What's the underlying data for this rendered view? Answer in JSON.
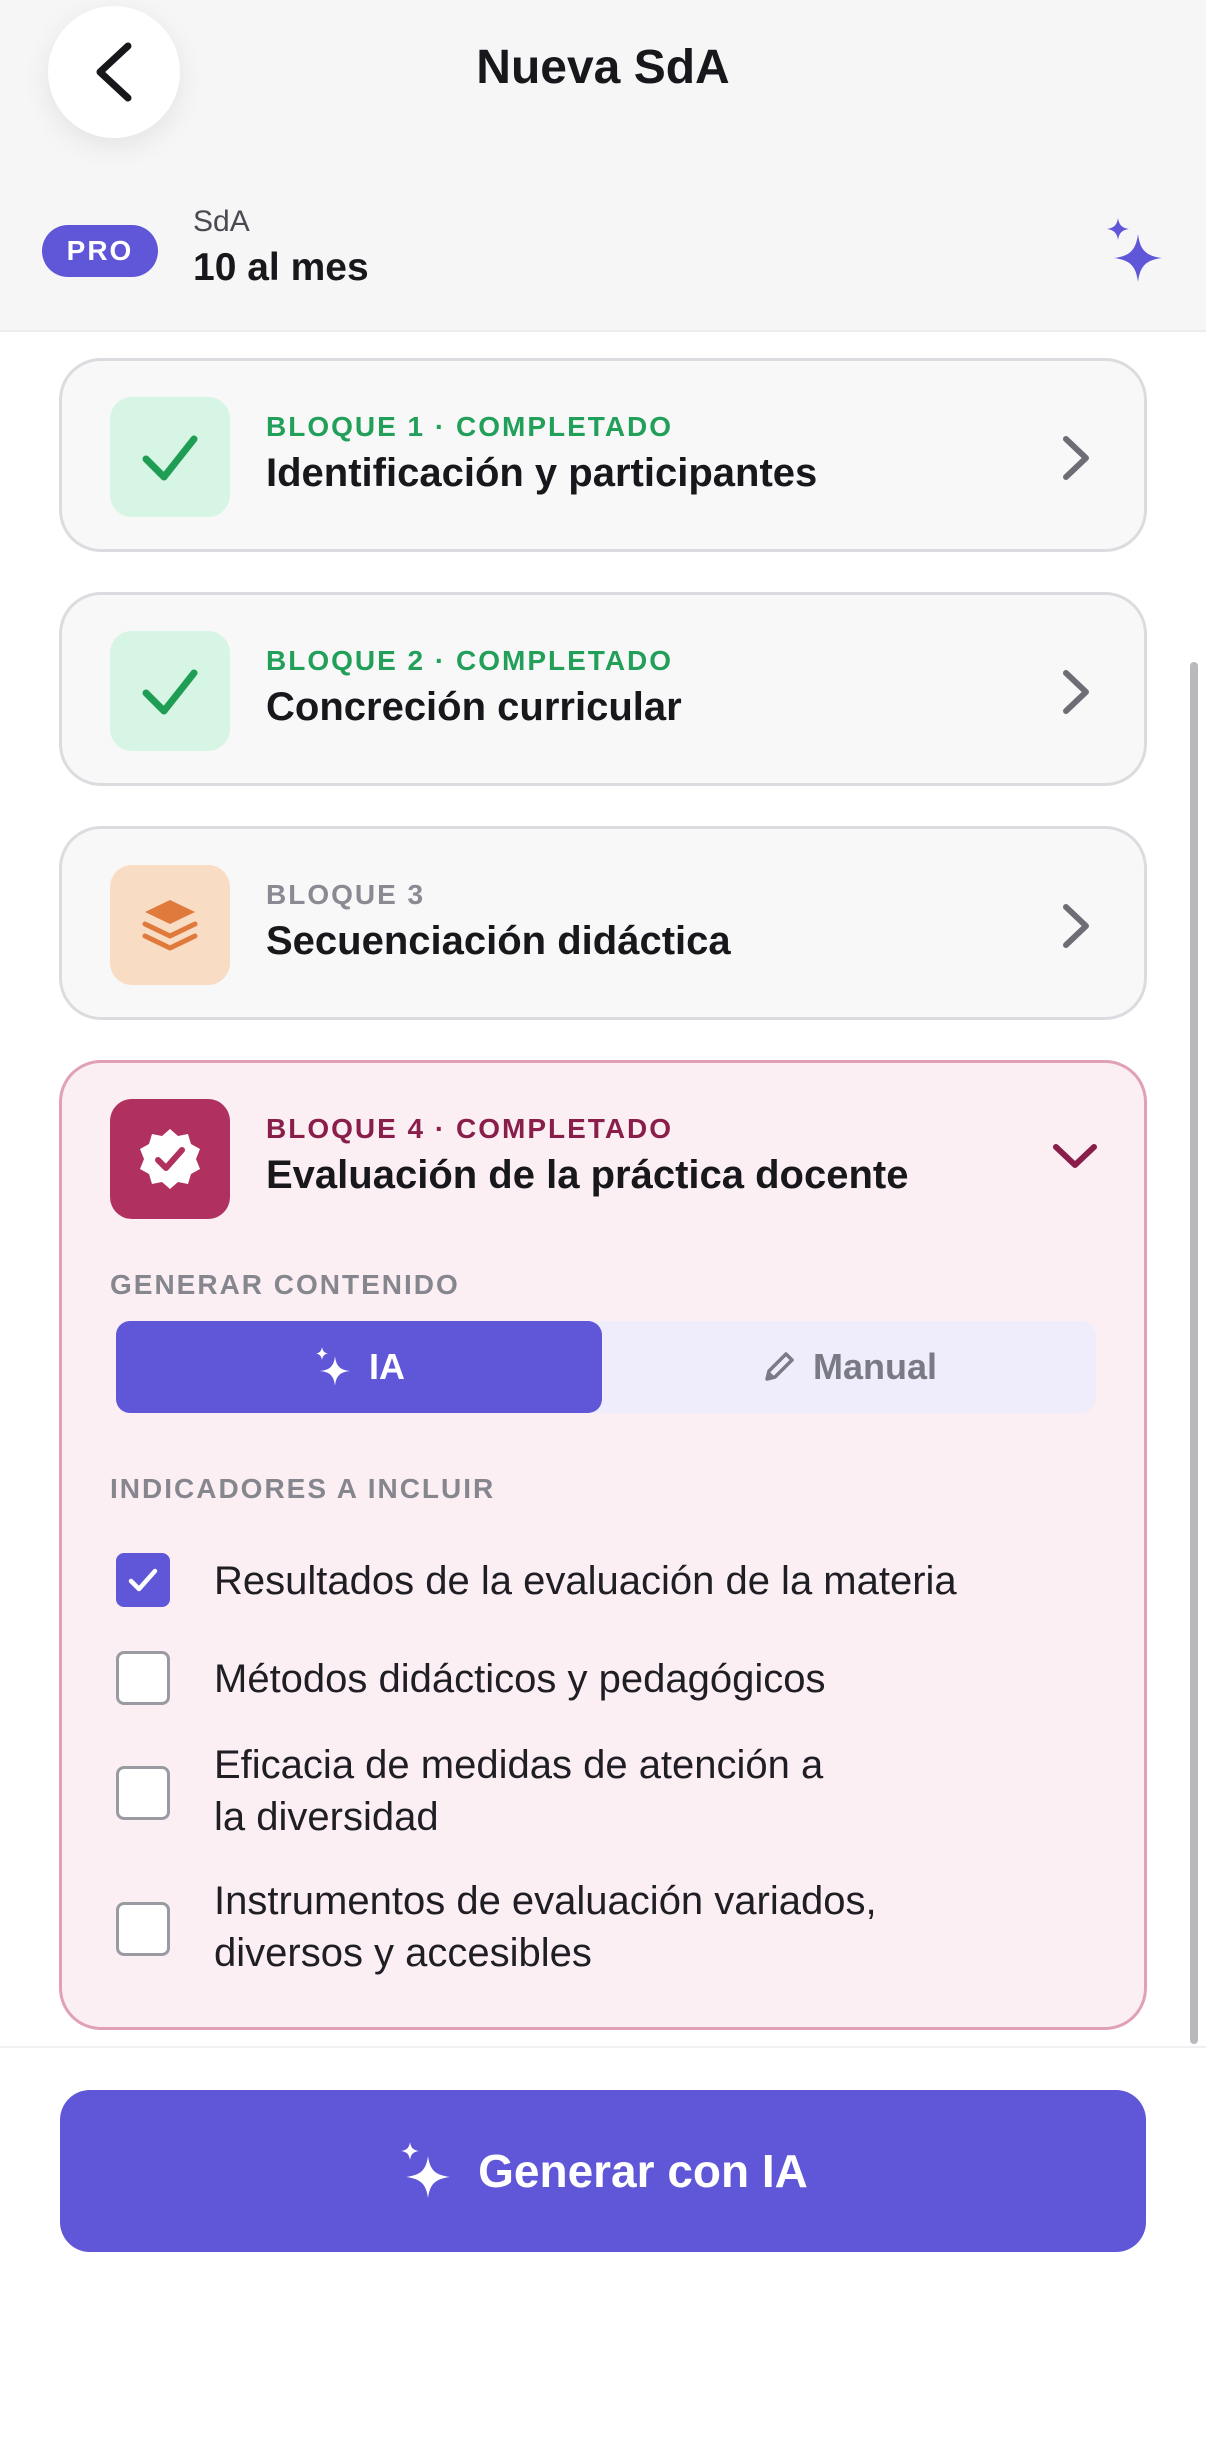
{
  "header": {
    "title": "Nueva SdA",
    "back_icon": "chevron-left-icon",
    "badge": "PRO",
    "quota_label": "SdA",
    "quota_value": "10 al mes",
    "ai_icon": "sparkles-icon"
  },
  "blocks": [
    {
      "kicker": "BLOQUE 1 · COMPLETADO",
      "title": "Identificación y participantes",
      "icon": "check-icon",
      "status": "completed"
    },
    {
      "kicker": "BLOQUE 2 · COMPLETADO",
      "title": "Concreción curricular",
      "icon": "check-icon",
      "status": "completed"
    },
    {
      "kicker": "BLOQUE 3",
      "title": "Secuenciación didáctica",
      "icon": "layers-icon",
      "status": "pending"
    },
    {
      "kicker": "BLOQUE 4 · COMPLETADO",
      "title": "Evaluación de la práctica docente",
      "icon": "verified-badge-icon",
      "status": "completed",
      "expanded": true,
      "generate_label": "GENERAR CONTENIDO",
      "mode_ia": "IA",
      "mode_manual": "Manual",
      "selected_mode": "IA",
      "indicators_label": "INDICADORES A INCLUIR",
      "indicators": [
        {
          "label": "Resultados de la evaluación de la materia",
          "checked": true
        },
        {
          "label": "Métodos didácticos y pedagógicos",
          "checked": false
        },
        {
          "label": "Eficacia de medidas de atención a\nla diversidad",
          "checked": false
        },
        {
          "label": "Instrumentos de evaluación variados,\ndiversos y accesibles",
          "checked": false
        }
      ]
    }
  ],
  "footer": {
    "generate_button": "Generar con IA"
  },
  "colors": {
    "accent": "#5f56d8",
    "success": "#22a05a",
    "wine": "#8a1e4b",
    "layers": "#e07a3c"
  }
}
